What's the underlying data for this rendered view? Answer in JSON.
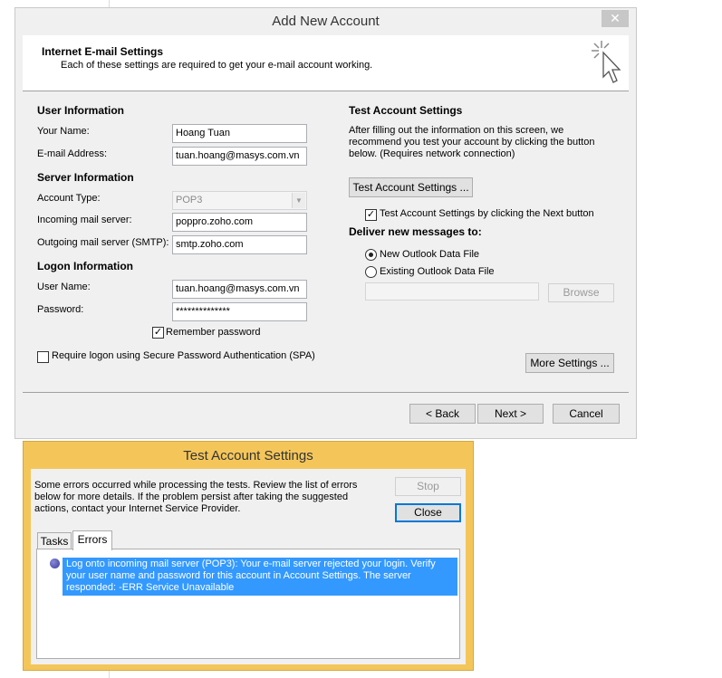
{
  "account_window": {
    "title": "Add New Account",
    "header_title": "Internet E-mail Settings",
    "header_subtitle": "Each of these settings are required to get your e-mail account working.",
    "user_info": {
      "heading": "User Information",
      "name_label": "Your Name:",
      "name_value": "Hoang Tuan",
      "email_label": "E-mail Address:",
      "email_value": "tuan.hoang@masys.com.vn"
    },
    "server_info": {
      "heading": "Server Information",
      "account_type_label": "Account Type:",
      "account_type_value": "POP3",
      "incoming_label": "Incoming mail server:",
      "incoming_value": "poppro.zoho.com",
      "outgoing_label": "Outgoing mail server (SMTP):",
      "outgoing_value": "smtp.zoho.com"
    },
    "logon_info": {
      "heading": "Logon Information",
      "username_label": "User Name:",
      "username_value": "tuan.hoang@masys.com.vn",
      "password_label": "Password:",
      "password_value": "**************",
      "remember_label": "Remember password",
      "remember_checked": true,
      "spa_label": "Require logon using Secure Password Authentication (SPA)",
      "spa_checked": false
    },
    "test_settings": {
      "heading": "Test Account Settings",
      "description": "After filling out the information on this screen, we recommend you test your account by clicking the button below. (Requires network connection)",
      "test_button": "Test Account Settings ...",
      "auto_test_label": "Test Account Settings by clicking the Next button",
      "auto_test_checked": true
    },
    "deliver": {
      "heading": "Deliver new messages to:",
      "new_file_label": "New Outlook Data File",
      "existing_file_label": "Existing Outlook Data File",
      "selected": "New Outlook Data File",
      "path_value": "",
      "browse_button": "Browse"
    },
    "more_settings_button": "More Settings ...",
    "back_button": "< Back",
    "next_button": "Next >",
    "cancel_button": "Cancel",
    "close_glyph": "✕"
  },
  "test_dialog": {
    "title": "Test Account Settings",
    "message": "Some errors occurred while processing the tests. Review the list of errors below for more details. If the problem persist after taking the suggested actions, contact your Internet Service Provider.",
    "stop_button": "Stop",
    "close_button": "Close",
    "tabs": [
      "Tasks",
      "Errors"
    ],
    "active_tab": "Errors",
    "errors": [
      {
        "icon": "error-bullet-icon",
        "text": "Log onto incoming mail server (POP3): Your e-mail server rejected your login. Verify your user name and password for this account in Account Settings.  The server responded: -ERR Service Unavailable"
      }
    ]
  }
}
